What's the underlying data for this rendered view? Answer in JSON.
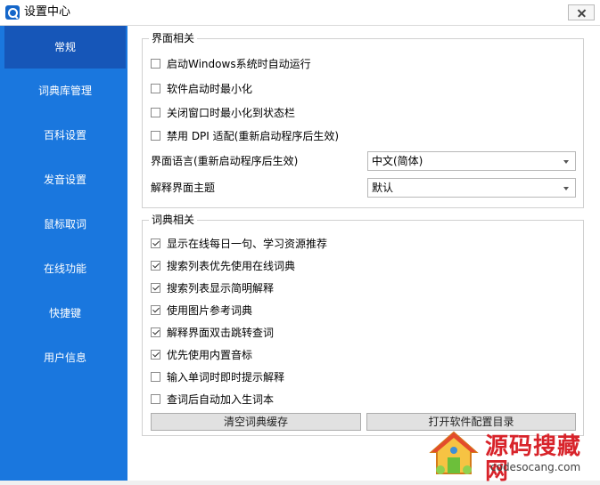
{
  "window": {
    "title": "设置中心"
  },
  "sidebar": {
    "items": [
      {
        "label": "常规"
      },
      {
        "label": "词典库管理"
      },
      {
        "label": "百科设置"
      },
      {
        "label": "发音设置"
      },
      {
        "label": "鼠标取词"
      },
      {
        "label": "在线功能"
      },
      {
        "label": "快捷键"
      },
      {
        "label": "用户信息"
      }
    ],
    "active_index": 0,
    "colors": {
      "background": "#1a77de",
      "active": "#1656b8"
    }
  },
  "interface_group": {
    "title": "界面相关",
    "options": [
      {
        "label": "启动Windows系统时自动运行",
        "checked": false
      },
      {
        "label": "软件启动时最小化",
        "checked": false
      },
      {
        "label": "关闭窗口时最小化到状态栏",
        "checked": false
      },
      {
        "label": "禁用 DPI 适配(重新启动程序后生效)",
        "checked": false
      }
    ],
    "language": {
      "label": "界面语言(重新启动程序后生效)",
      "value": "中文(简体)"
    },
    "theme": {
      "label": "解释界面主题",
      "value": "默认"
    }
  },
  "dictionary_group": {
    "title": "词典相关",
    "options": [
      {
        "label": "显示在线每日一句、学习资源推荐",
        "checked": true
      },
      {
        "label": "搜索列表优先使用在线词典",
        "checked": true
      },
      {
        "label": "搜索列表显示简明解释",
        "checked": true
      },
      {
        "label": "使用图片参考词典",
        "checked": true
      },
      {
        "label": "解释界面双击跳转查词",
        "checked": true
      },
      {
        "label": "优先使用内置音标",
        "checked": true
      },
      {
        "label": "输入单词时即时提示解释",
        "checked": false
      },
      {
        "label": "查词后自动加入生词本",
        "checked": false
      }
    ],
    "clear_cache_button": "清空词典缓存",
    "open_config_button": "打开软件配置目录"
  },
  "watermark": {
    "main": "源码搜藏网",
    "url": "codesocang.com"
  }
}
